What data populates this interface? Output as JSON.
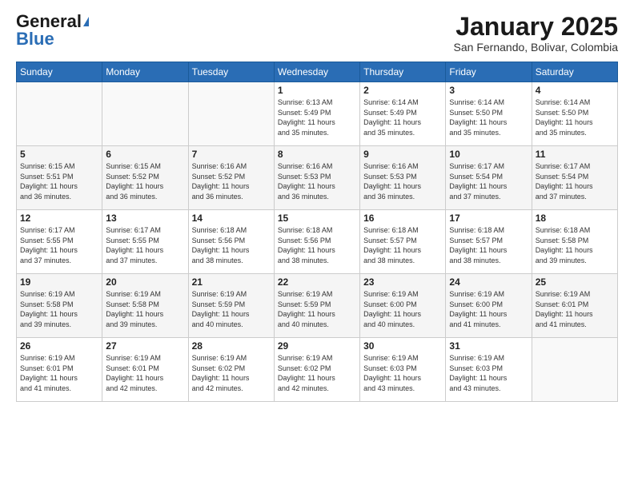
{
  "logo": {
    "general": "General",
    "blue": "Blue"
  },
  "header": {
    "month": "January 2025",
    "location": "San Fernando, Bolivar, Colombia"
  },
  "weekdays": [
    "Sunday",
    "Monday",
    "Tuesday",
    "Wednesday",
    "Thursday",
    "Friday",
    "Saturday"
  ],
  "weeks": [
    [
      {
        "day": "",
        "info": ""
      },
      {
        "day": "",
        "info": ""
      },
      {
        "day": "",
        "info": ""
      },
      {
        "day": "1",
        "info": "Sunrise: 6:13 AM\nSunset: 5:49 PM\nDaylight: 11 hours\nand 35 minutes."
      },
      {
        "day": "2",
        "info": "Sunrise: 6:14 AM\nSunset: 5:49 PM\nDaylight: 11 hours\nand 35 minutes."
      },
      {
        "day": "3",
        "info": "Sunrise: 6:14 AM\nSunset: 5:50 PM\nDaylight: 11 hours\nand 35 minutes."
      },
      {
        "day": "4",
        "info": "Sunrise: 6:14 AM\nSunset: 5:50 PM\nDaylight: 11 hours\nand 35 minutes."
      }
    ],
    [
      {
        "day": "5",
        "info": "Sunrise: 6:15 AM\nSunset: 5:51 PM\nDaylight: 11 hours\nand 36 minutes."
      },
      {
        "day": "6",
        "info": "Sunrise: 6:15 AM\nSunset: 5:52 PM\nDaylight: 11 hours\nand 36 minutes."
      },
      {
        "day": "7",
        "info": "Sunrise: 6:16 AM\nSunset: 5:52 PM\nDaylight: 11 hours\nand 36 minutes."
      },
      {
        "day": "8",
        "info": "Sunrise: 6:16 AM\nSunset: 5:53 PM\nDaylight: 11 hours\nand 36 minutes."
      },
      {
        "day": "9",
        "info": "Sunrise: 6:16 AM\nSunset: 5:53 PM\nDaylight: 11 hours\nand 36 minutes."
      },
      {
        "day": "10",
        "info": "Sunrise: 6:17 AM\nSunset: 5:54 PM\nDaylight: 11 hours\nand 37 minutes."
      },
      {
        "day": "11",
        "info": "Sunrise: 6:17 AM\nSunset: 5:54 PM\nDaylight: 11 hours\nand 37 minutes."
      }
    ],
    [
      {
        "day": "12",
        "info": "Sunrise: 6:17 AM\nSunset: 5:55 PM\nDaylight: 11 hours\nand 37 minutes."
      },
      {
        "day": "13",
        "info": "Sunrise: 6:17 AM\nSunset: 5:55 PM\nDaylight: 11 hours\nand 37 minutes."
      },
      {
        "day": "14",
        "info": "Sunrise: 6:18 AM\nSunset: 5:56 PM\nDaylight: 11 hours\nand 38 minutes."
      },
      {
        "day": "15",
        "info": "Sunrise: 6:18 AM\nSunset: 5:56 PM\nDaylight: 11 hours\nand 38 minutes."
      },
      {
        "day": "16",
        "info": "Sunrise: 6:18 AM\nSunset: 5:57 PM\nDaylight: 11 hours\nand 38 minutes."
      },
      {
        "day": "17",
        "info": "Sunrise: 6:18 AM\nSunset: 5:57 PM\nDaylight: 11 hours\nand 38 minutes."
      },
      {
        "day": "18",
        "info": "Sunrise: 6:18 AM\nSunset: 5:58 PM\nDaylight: 11 hours\nand 39 minutes."
      }
    ],
    [
      {
        "day": "19",
        "info": "Sunrise: 6:19 AM\nSunset: 5:58 PM\nDaylight: 11 hours\nand 39 minutes."
      },
      {
        "day": "20",
        "info": "Sunrise: 6:19 AM\nSunset: 5:58 PM\nDaylight: 11 hours\nand 39 minutes."
      },
      {
        "day": "21",
        "info": "Sunrise: 6:19 AM\nSunset: 5:59 PM\nDaylight: 11 hours\nand 40 minutes."
      },
      {
        "day": "22",
        "info": "Sunrise: 6:19 AM\nSunset: 5:59 PM\nDaylight: 11 hours\nand 40 minutes."
      },
      {
        "day": "23",
        "info": "Sunrise: 6:19 AM\nSunset: 6:00 PM\nDaylight: 11 hours\nand 40 minutes."
      },
      {
        "day": "24",
        "info": "Sunrise: 6:19 AM\nSunset: 6:00 PM\nDaylight: 11 hours\nand 41 minutes."
      },
      {
        "day": "25",
        "info": "Sunrise: 6:19 AM\nSunset: 6:01 PM\nDaylight: 11 hours\nand 41 minutes."
      }
    ],
    [
      {
        "day": "26",
        "info": "Sunrise: 6:19 AM\nSunset: 6:01 PM\nDaylight: 11 hours\nand 41 minutes."
      },
      {
        "day": "27",
        "info": "Sunrise: 6:19 AM\nSunset: 6:01 PM\nDaylight: 11 hours\nand 42 minutes."
      },
      {
        "day": "28",
        "info": "Sunrise: 6:19 AM\nSunset: 6:02 PM\nDaylight: 11 hours\nand 42 minutes."
      },
      {
        "day": "29",
        "info": "Sunrise: 6:19 AM\nSunset: 6:02 PM\nDaylight: 11 hours\nand 42 minutes."
      },
      {
        "day": "30",
        "info": "Sunrise: 6:19 AM\nSunset: 6:03 PM\nDaylight: 11 hours\nand 43 minutes."
      },
      {
        "day": "31",
        "info": "Sunrise: 6:19 AM\nSunset: 6:03 PM\nDaylight: 11 hours\nand 43 minutes."
      },
      {
        "day": "",
        "info": ""
      }
    ]
  ]
}
